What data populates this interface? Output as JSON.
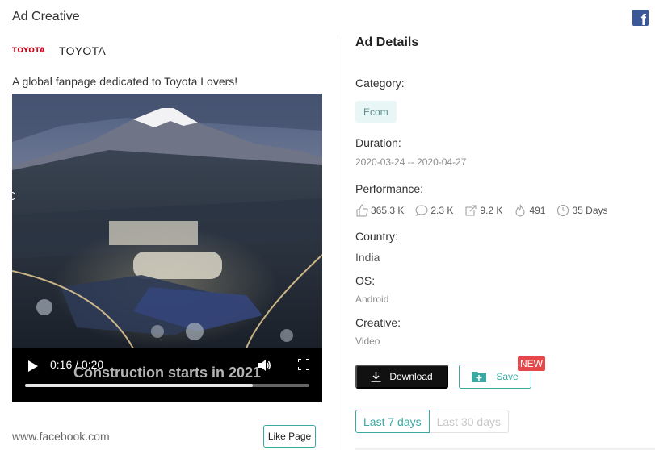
{
  "panel": {
    "title": "Ad Creative"
  },
  "brand": {
    "logo_text": "TOYOTA",
    "name": "TOYOTA"
  },
  "ad": {
    "text": "A global fanpage dedicated to Toyota Lovers!",
    "video": {
      "subtitle": "Construction starts in 2021",
      "time": "0:16 / 0:20",
      "progress": 0.8
    },
    "site": "www.facebook.com",
    "like_label": "Like Page"
  },
  "details": {
    "title": "Ad Details",
    "category_label": "Category:",
    "category_tag": "Ecom",
    "duration_label": "Duration:",
    "duration_value": "2020-03-24 -- 2020-04-27",
    "performance_label": "Performance:",
    "performance": {
      "likes": "365.3 K",
      "comments": "2.3 K",
      "shares": "9.2 K",
      "popularity": "491",
      "days": "35 Days"
    },
    "country_label": "Country:",
    "country_value": "India",
    "os_label": "OS:",
    "os_value": "Android",
    "creative_label": "Creative:",
    "creative_value": "Video"
  },
  "actions": {
    "download_label": "Download",
    "save_label": "Save",
    "new_badge": "NEW"
  },
  "ranges": {
    "active": "Last 7 days",
    "inactive": "Last 30 days"
  },
  "colors": {
    "accent": "#3aa9a1",
    "facebook": "#3b5998",
    "badge": "#e5474b"
  }
}
